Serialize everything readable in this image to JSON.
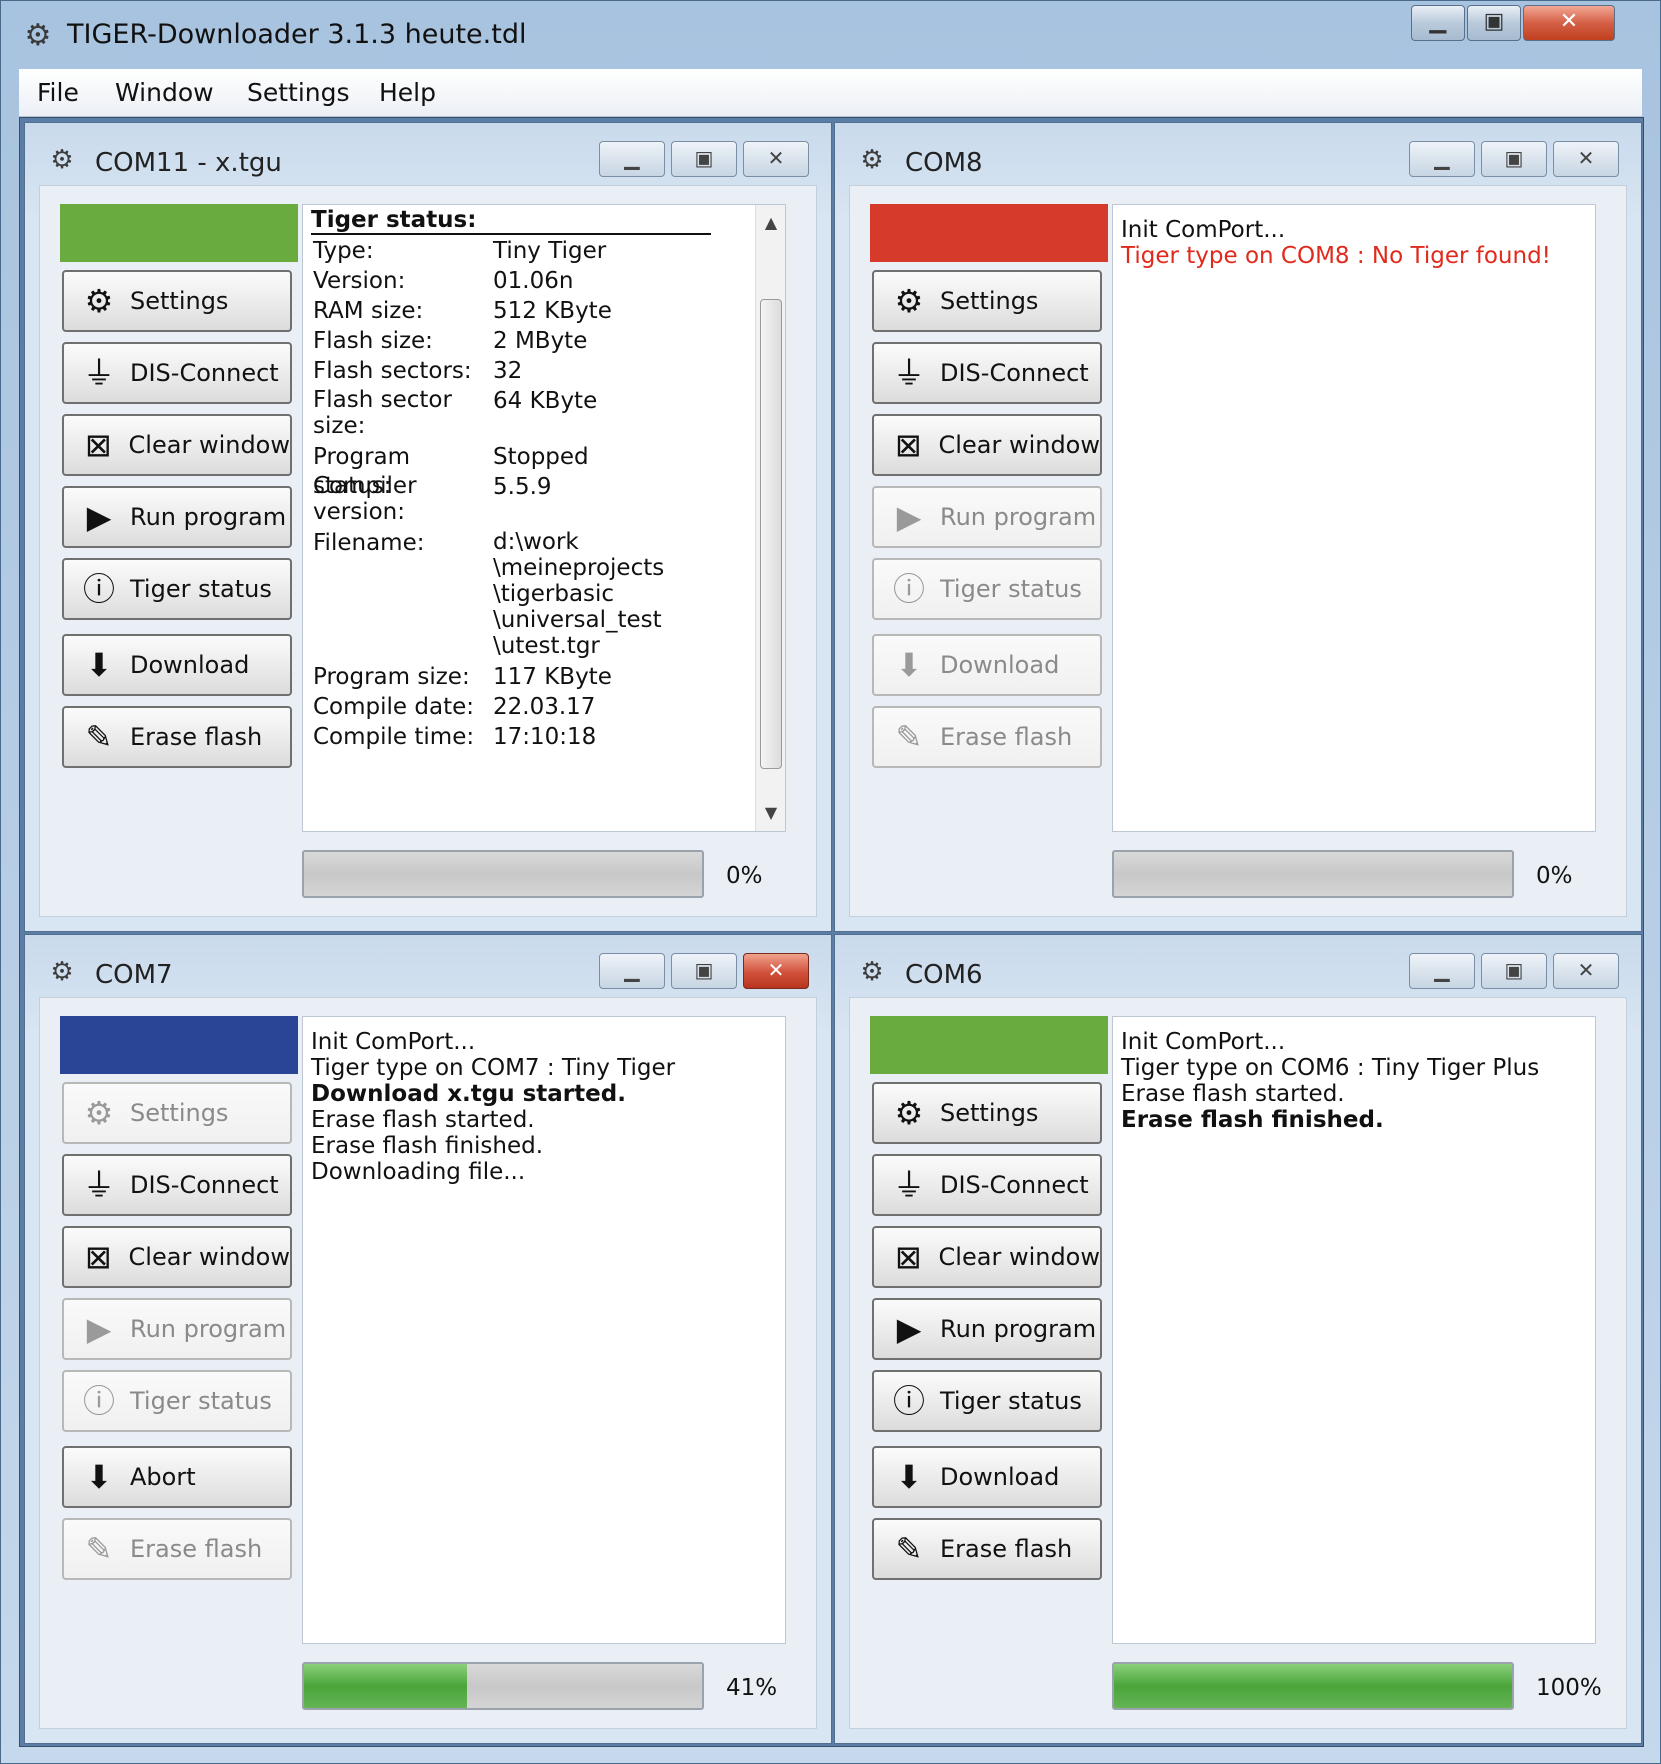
{
  "app": {
    "title": "TIGER-Downloader 3.1.3 heute.tdl"
  },
  "menu": [
    "File",
    "Window",
    "Settings",
    "Help"
  ],
  "windows": [
    {
      "title": "COM11 - x.tgu",
      "status_color": "#6aab3f",
      "buttons": [
        {
          "label": "Settings",
          "icon": "gear-icon",
          "enabled": true
        },
        {
          "label": "DIS-Connect",
          "icon": "plug-icon",
          "enabled": true
        },
        {
          "label": "Clear window",
          "icon": "clear-icon",
          "enabled": true
        },
        {
          "label": "Run program",
          "icon": "run-icon",
          "enabled": true
        },
        {
          "label": "Tiger status",
          "icon": "info-icon",
          "enabled": true
        },
        {
          "label": "Download",
          "icon": "download-icon",
          "enabled": true
        },
        {
          "label": "Erase flash",
          "icon": "erase-icon",
          "enabled": true
        }
      ],
      "tiger_status": {
        "heading": "Tiger status:",
        "rows": [
          {
            "key": "Type:",
            "value": "Tiny Tiger"
          },
          {
            "key": "Version:",
            "value": "01.06n"
          },
          {
            "key": "RAM size:",
            "value": "512 KByte"
          },
          {
            "key": "Flash size:",
            "value": "2 MByte"
          },
          {
            "key": "Flash sectors:",
            "value": "32"
          },
          {
            "key": "Flash sector size:",
            "value": "64 KByte"
          },
          {
            "key": "Program status:",
            "value": "Stopped"
          },
          {
            "key": "Compiler version:",
            "value": "5.5.9"
          },
          {
            "key": "Filename:",
            "value": "d:\\work\\meineprojects\\tigerbasic\\universal_test\\utest.tgr"
          },
          {
            "key": "Program size:",
            "value": "117 KByte"
          },
          {
            "key": "Compile date:",
            "value": "22.03.17"
          },
          {
            "key": "Compile time:",
            "value": "17:10:18"
          }
        ]
      },
      "progress": 0,
      "progress_label": "0%"
    },
    {
      "title": "COM8",
      "status_color": "#d63a2a",
      "buttons": [
        {
          "label": "Settings",
          "icon": "gear-icon",
          "enabled": true
        },
        {
          "label": "DIS-Connect",
          "icon": "plug-icon",
          "enabled": true
        },
        {
          "label": "Clear window",
          "icon": "clear-icon",
          "enabled": true
        },
        {
          "label": "Run program",
          "icon": "run-icon",
          "enabled": false
        },
        {
          "label": "Tiger status",
          "icon": "info-icon",
          "enabled": false
        },
        {
          "label": "Download",
          "icon": "download-icon",
          "enabled": false
        },
        {
          "label": "Erase flash",
          "icon": "erase-icon",
          "enabled": false
        }
      ],
      "log": [
        {
          "text": "Init ComPort...",
          "style": "normal"
        },
        {
          "text": "Tiger type on COM8 : No Tiger found!",
          "style": "red"
        }
      ],
      "progress": 0,
      "progress_label": "0%"
    },
    {
      "title": "COM7",
      "status_color": "#2b4596",
      "buttons": [
        {
          "label": "Settings",
          "icon": "gear-icon",
          "enabled": false
        },
        {
          "label": "DIS-Connect",
          "icon": "plug-icon",
          "enabled": true
        },
        {
          "label": "Clear window",
          "icon": "clear-icon",
          "enabled": true
        },
        {
          "label": "Run program",
          "icon": "run-icon",
          "enabled": false
        },
        {
          "label": "Tiger status",
          "icon": "info-icon",
          "enabled": false
        },
        {
          "label": "Abort",
          "icon": "download-icon",
          "enabled": true
        },
        {
          "label": "Erase flash",
          "icon": "erase-icon",
          "enabled": false
        }
      ],
      "log": [
        {
          "text": "Init ComPort...",
          "style": "normal"
        },
        {
          "text": "Tiger type on COM7 : Tiny Tiger",
          "style": "normal"
        },
        {
          "text": "Download x.tgu started.",
          "style": "bold"
        },
        {
          "text": "Erase flash started.",
          "style": "normal"
        },
        {
          "text": "Erase flash finished.",
          "style": "normal"
        },
        {
          "text": "Downloading file...",
          "style": "normal"
        }
      ],
      "progress": 0.41,
      "progress_label": "41%"
    },
    {
      "title": "COM6",
      "status_color": "#6aab3f",
      "buttons": [
        {
          "label": "Settings",
          "icon": "gear-icon",
          "enabled": true
        },
        {
          "label": "DIS-Connect",
          "icon": "plug-icon",
          "enabled": true
        },
        {
          "label": "Clear window",
          "icon": "clear-icon",
          "enabled": true
        },
        {
          "label": "Run program",
          "icon": "run-icon",
          "enabled": true
        },
        {
          "label": "Tiger status",
          "icon": "info-icon",
          "enabled": true
        },
        {
          "label": "Download",
          "icon": "download-icon",
          "enabled": true
        },
        {
          "label": "Erase flash",
          "icon": "erase-icon",
          "enabled": true
        }
      ],
      "log": [
        {
          "text": "Init ComPort...",
          "style": "normal"
        },
        {
          "text": "Tiger type on COM6 : Tiny Tiger Plus",
          "style": "normal"
        },
        {
          "text": "Erase flash started.",
          "style": "normal"
        },
        {
          "text": "Erase flash finished.",
          "style": "bold"
        }
      ],
      "progress": 1.0,
      "progress_label": "100%"
    }
  ]
}
